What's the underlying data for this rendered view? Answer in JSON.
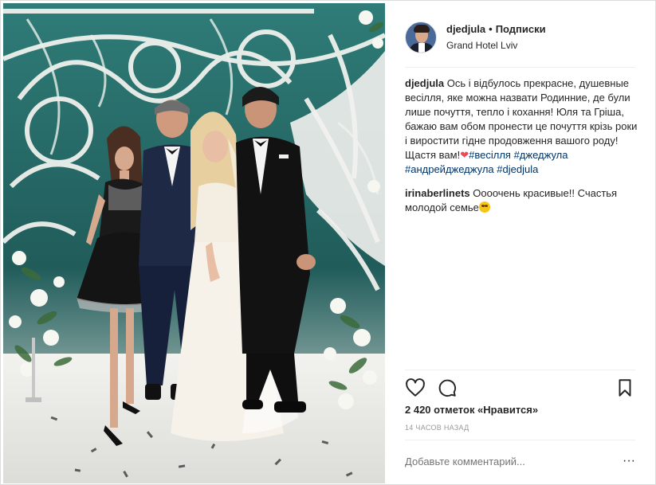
{
  "post": {
    "username": "djedjula",
    "separator": "•",
    "follow_label": "Подписки",
    "location": "Grand Hotel Lviv",
    "photo_icon": "wedding-photo"
  },
  "caption": {
    "user": "djedjula",
    "text": "Ось і відбулось прекрасне, душевные весілля, яке можна назвати Родинние, де були лише почуття, тепло і кохання! Юля та Гріша, бажаю вам обом пронести це почуття крізь роки і виростити гідне продовження вашого роду! Щастя вам!",
    "heart": "❤",
    "hashtags": [
      "#весілля",
      "#джеджула",
      "#андрейджеджула",
      "#djedjula"
    ]
  },
  "comments": [
    {
      "user": "irinaberlinets",
      "text": "Оооочень красивые!! Счастья молодой семье"
    }
  ],
  "actions": {
    "like_icon": "heart-icon",
    "comment_icon": "speech-bubble-icon",
    "save_icon": "bookmark-icon"
  },
  "likes_text": "2 420 отметок «Нравится»",
  "time_text": "14 часов назад",
  "add_comment_placeholder": "Добавьте комментарий...",
  "more_label": "···",
  "colors": {
    "hashtag": "#003569",
    "text": "#262626",
    "muted": "#999999",
    "border": "#efefef"
  }
}
